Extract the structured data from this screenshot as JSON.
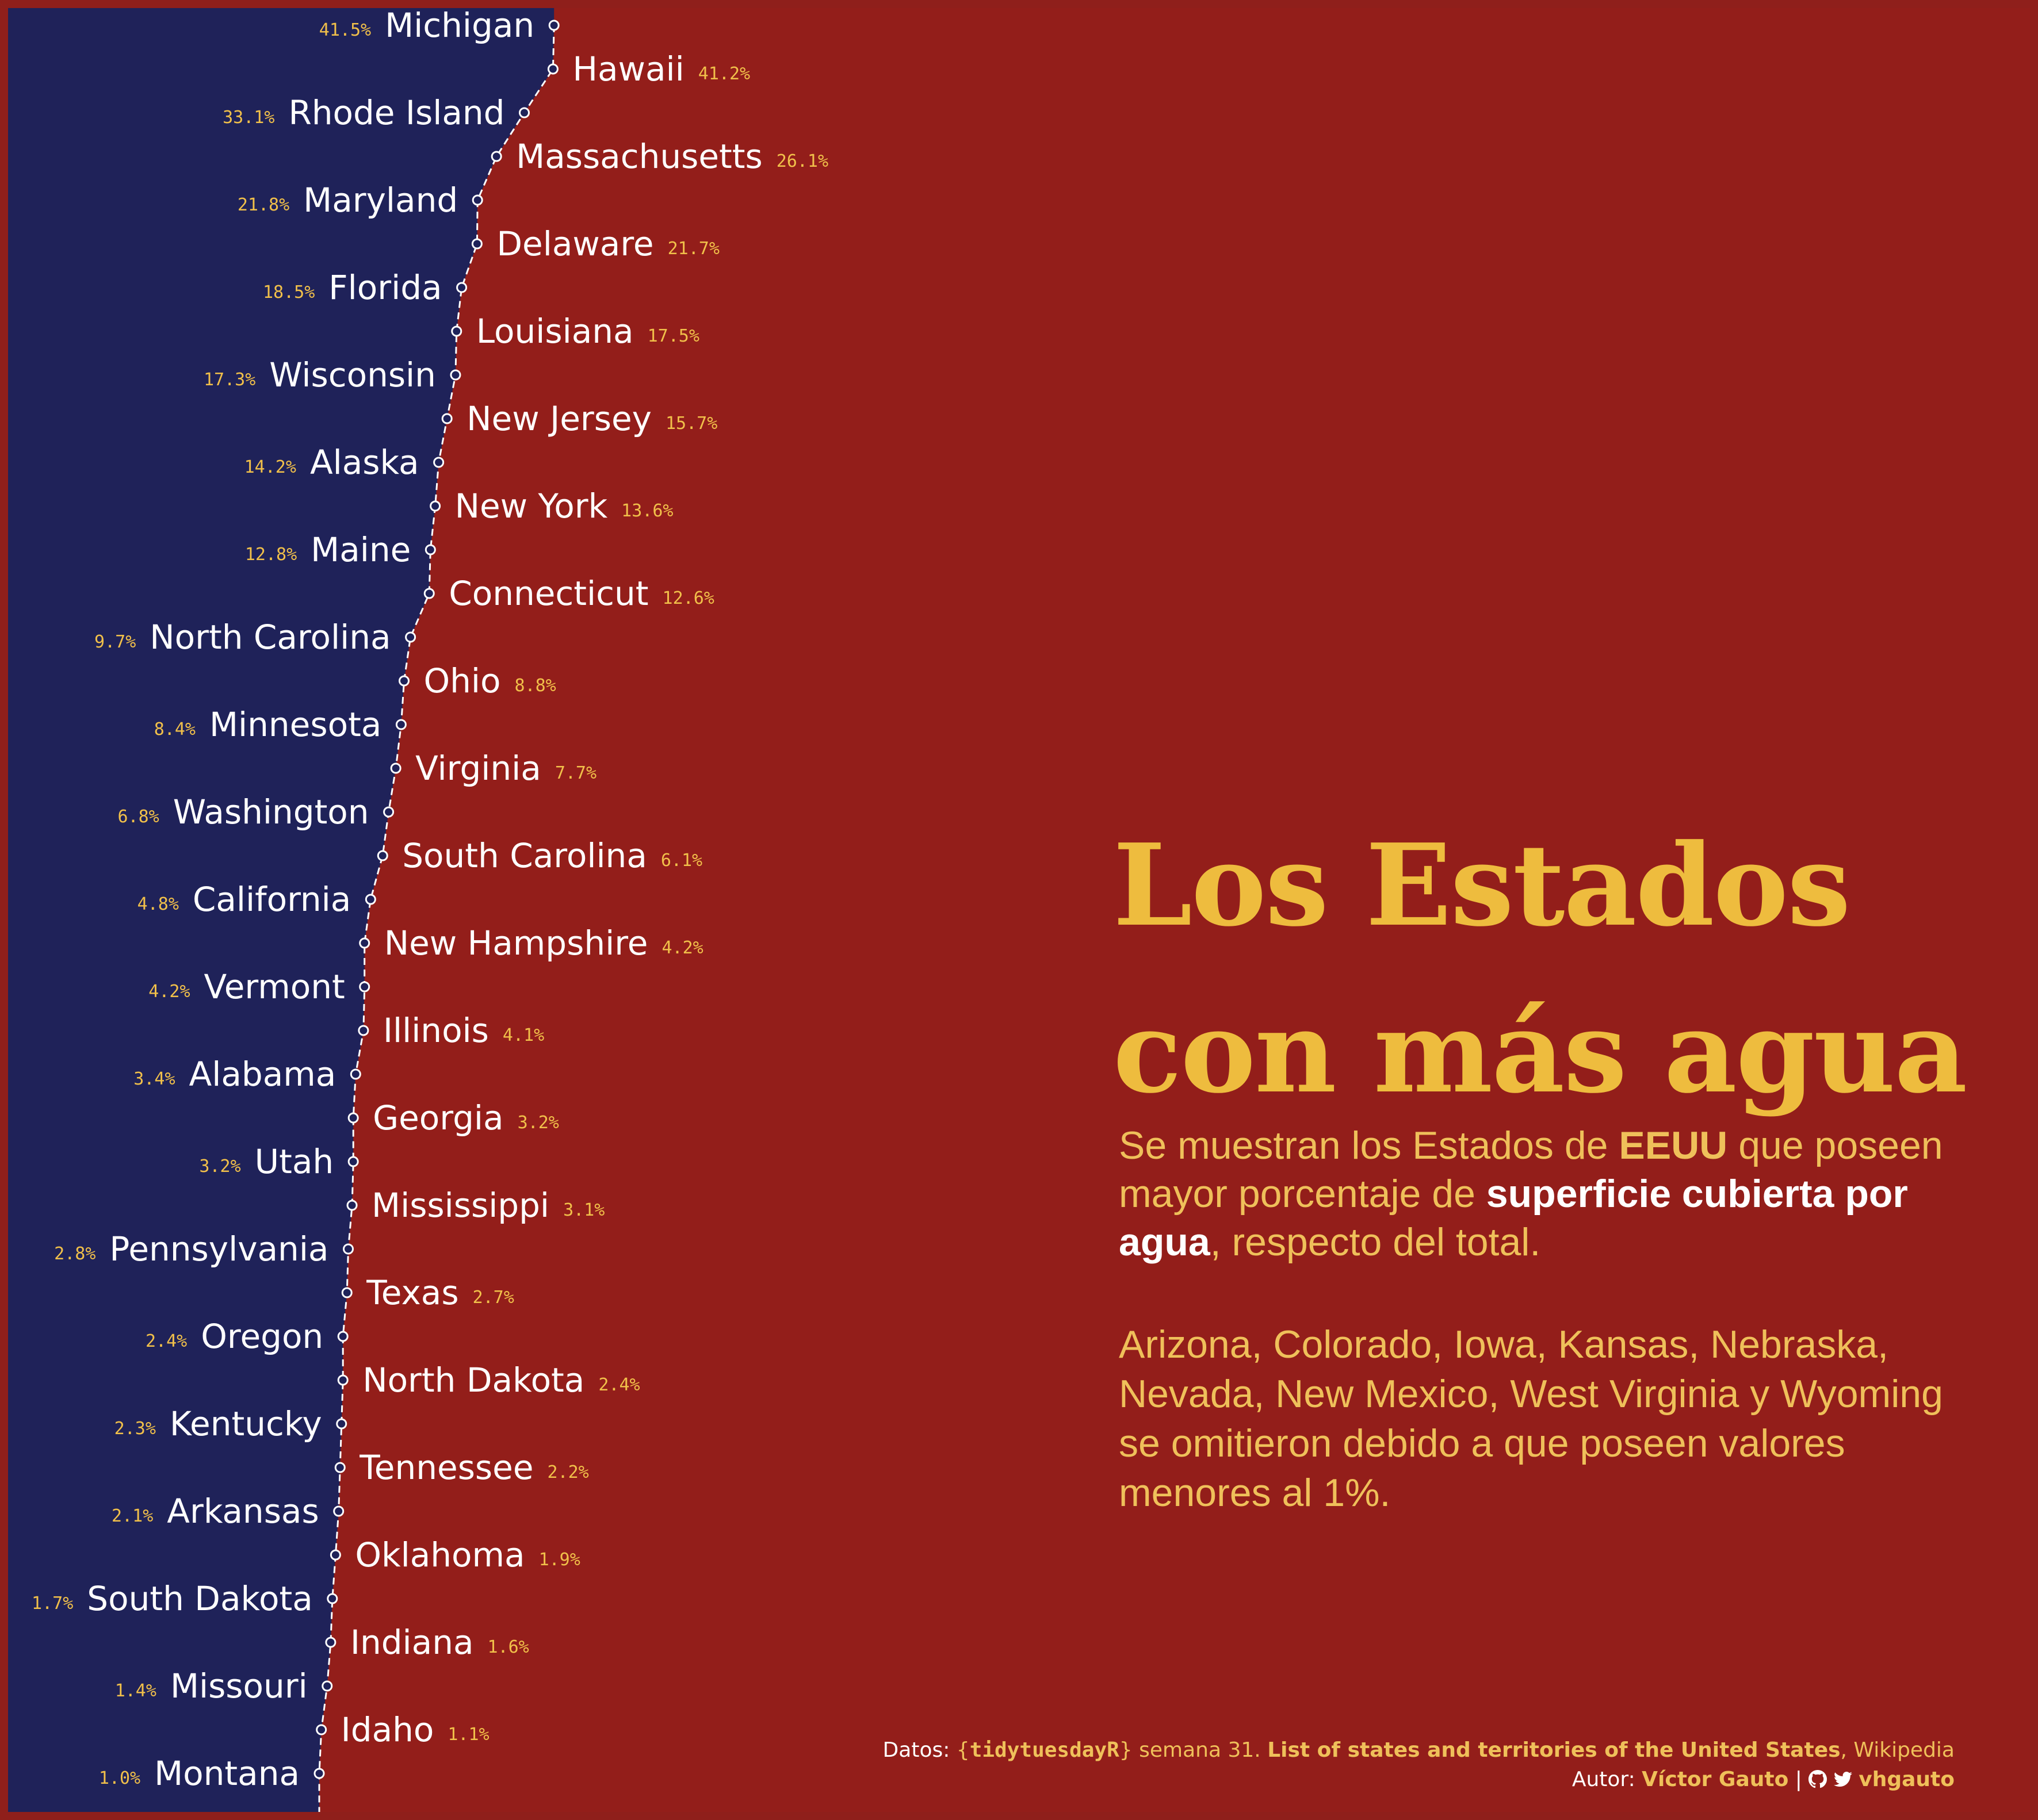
{
  "chart_data": {
    "type": "area",
    "title_lines": [
      "Los Estados",
      "con más agua"
    ],
    "description": {
      "p1": "Se muestran los Estados de ",
      "b1": "EEUU",
      "p2": " que poseen mayor porcentaje de ",
      "b2": "superficie cubierta por agua",
      "p3": ", respecto del total."
    },
    "note": "Arizona, Colorado, Iowa, Kansas, Nebraska, Nevada, New Mexico, West Virginia y Wyoming se omitieron debido a que poseen valores menores al 1%.",
    "states": [
      {
        "name": "Michigan",
        "value": 41.5,
        "label": "41.5%"
      },
      {
        "name": "Hawaii",
        "value": 41.2,
        "label": "41.2%"
      },
      {
        "name": "Rhode Island",
        "value": 33.1,
        "label": "33.1%"
      },
      {
        "name": "Massachusetts",
        "value": 26.1,
        "label": "26.1%"
      },
      {
        "name": "Maryland",
        "value": 21.8,
        "label": "21.8%"
      },
      {
        "name": "Delaware",
        "value": 21.7,
        "label": "21.7%"
      },
      {
        "name": "Florida",
        "value": 18.5,
        "label": "18.5%"
      },
      {
        "name": "Louisiana",
        "value": 17.5,
        "label": "17.5%"
      },
      {
        "name": "Wisconsin",
        "value": 17.3,
        "label": "17.3%"
      },
      {
        "name": "New Jersey",
        "value": 15.7,
        "label": "15.7%"
      },
      {
        "name": "Alaska",
        "value": 14.2,
        "label": "14.2%"
      },
      {
        "name": "New York",
        "value": 13.6,
        "label": "13.6%"
      },
      {
        "name": "Maine",
        "value": 12.8,
        "label": "12.8%"
      },
      {
        "name": "Connecticut",
        "value": 12.6,
        "label": "12.6%"
      },
      {
        "name": "North Carolina",
        "value": 9.7,
        "label": "9.7%"
      },
      {
        "name": "Ohio",
        "value": 8.8,
        "label": "8.8%"
      },
      {
        "name": "Minnesota",
        "value": 8.4,
        "label": "8.4%"
      },
      {
        "name": "Virginia",
        "value": 7.7,
        "label": "7.7%"
      },
      {
        "name": "Washington",
        "value": 6.8,
        "label": "6.8%"
      },
      {
        "name": "South Carolina",
        "value": 6.1,
        "label": "6.1%"
      },
      {
        "name": "California",
        "value": 4.8,
        "label": "4.8%"
      },
      {
        "name": "New Hampshire",
        "value": 4.2,
        "label": "4.2%"
      },
      {
        "name": "Vermont",
        "value": 4.2,
        "label": "4.2%"
      },
      {
        "name": "Illinois",
        "value": 4.1,
        "label": "4.1%"
      },
      {
        "name": "Alabama",
        "value": 3.4,
        "label": "3.4%"
      },
      {
        "name": "Georgia",
        "value": 3.2,
        "label": "3.2%"
      },
      {
        "name": "Utah",
        "value": 3.2,
        "label": "3.2%"
      },
      {
        "name": "Mississippi",
        "value": 3.1,
        "label": "3.1%"
      },
      {
        "name": "Pennsylvania",
        "value": 2.8,
        "label": "2.8%"
      },
      {
        "name": "Texas",
        "value": 2.7,
        "label": "2.7%"
      },
      {
        "name": "Oregon",
        "value": 2.4,
        "label": "2.4%"
      },
      {
        "name": "North Dakota",
        "value": 2.4,
        "label": "2.4%"
      },
      {
        "name": "Kentucky",
        "value": 2.3,
        "label": "2.3%"
      },
      {
        "name": "Tennessee",
        "value": 2.2,
        "label": "2.2%"
      },
      {
        "name": "Arkansas",
        "value": 2.1,
        "label": "2.1%"
      },
      {
        "name": "Oklahoma",
        "value": 1.9,
        "label": "1.9%"
      },
      {
        "name": "South Dakota",
        "value": 1.7,
        "label": "1.7%"
      },
      {
        "name": "Indiana",
        "value": 1.6,
        "label": "1.6%"
      },
      {
        "name": "Missouri",
        "value": 1.4,
        "label": "1.4%"
      },
      {
        "name": "Idaho",
        "value": 1.1,
        "label": "1.1%"
      },
      {
        "name": "Montana",
        "value": 1.0,
        "label": "1.0%"
      }
    ],
    "colors": {
      "water": "#1f2259",
      "land": "#931e1a",
      "border": "#8f1f1b",
      "state_label": "#ffffff",
      "value_label": "#f1c04a",
      "title": "#eebc3e"
    }
  },
  "credits": {
    "data_prefix": "Datos: ",
    "brace_open": "{",
    "package": "tidytuesdayR",
    "brace_close": "}",
    "week": " semana 31. ",
    "source_bold": "List of states and territories of the United States",
    "source_rest": ", Wikipedia",
    "author_prefix": "Autor: ",
    "author_name": "Víctor Gauto",
    "separator": " | ",
    "handle": "vhgauto"
  }
}
